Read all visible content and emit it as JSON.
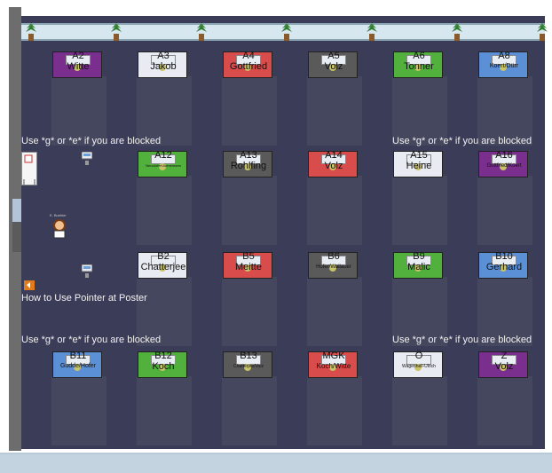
{
  "booths": [
    {
      "code": "A2",
      "name": "Witte",
      "color": "#7a2e8e",
      "name_size": 11
    },
    {
      "code": "A3",
      "name": "Jakob",
      "color": "#e8ebf2",
      "name_size": 11
    },
    {
      "code": "A4",
      "name": "Gottfried",
      "color": "#d94c4c",
      "name_size": 11
    },
    {
      "code": "A5",
      "name": "Volz",
      "color": "#5a5a5a",
      "name_size": 11
    },
    {
      "code": "A6",
      "name": "Tonner",
      "color": "#52b13c",
      "name_size": 11
    },
    {
      "code": "A8",
      "name": "Koert/Dürr",
      "color": "#5b8fd6",
      "name_size": 7
    },
    {
      "code": "A12",
      "name": "Neudörfer/Juenemann",
      "color": "#52b13c",
      "name_size": 4
    },
    {
      "code": "A13",
      "name": "Rohlfing",
      "color": "#5a5a5a",
      "name_size": 11
    },
    {
      "code": "A14",
      "name": "Volz",
      "color": "#d94c4c",
      "name_size": 11
    },
    {
      "code": "A15",
      "name": "Heine",
      "color": "#e8ebf2",
      "name_size": 11
    },
    {
      "code": "A16",
      "name": "Gottfried/Koert",
      "color": "#7a2e8e",
      "name_size": 6
    },
    {
      "code": "B2",
      "name": "Chatterjee",
      "color": "#e8ebf2",
      "name_size": 11
    },
    {
      "code": "B5",
      "name": "Meitte",
      "color": "#d94c4c",
      "name_size": 11
    },
    {
      "code": "B6",
      "name": "Hofer/Wallauer",
      "color": "#5a5a5a",
      "name_size": 6
    },
    {
      "code": "B9",
      "name": "Malic",
      "color": "#52b13c",
      "name_size": 11
    },
    {
      "code": "B10",
      "name": "Gerhard",
      "color": "#5b8fd6",
      "name_size": 11
    },
    {
      "code": "B11",
      "name": "Gudde/Hofer",
      "color": "#5b8fd6",
      "name_size": 7
    },
    {
      "code": "B12",
      "name": "Koch",
      "color": "#52b13c",
      "name_size": 11
    },
    {
      "code": "B13",
      "name": "Chatterjee/Volz",
      "color": "#5a5a5a",
      "name_size": 5
    },
    {
      "code": "MGK",
      "name": "Koch/Witte",
      "color": "#d94c4c",
      "name_size": 8
    },
    {
      "code": "Ö",
      "name": "Wagenheil-Ulrich",
      "color": "#e8ebf2",
      "name_size": 5
    },
    {
      "code": "Z",
      "name": "Volz",
      "color": "#7a2e8e",
      "name_size": 11
    }
  ],
  "messages": {
    "blocked": "Use *g* or *e* if you are blocked",
    "howto": "How to Use Pointer at Poster"
  },
  "avatar": {
    "name": "E. Buehler"
  },
  "colors": {
    "room": "#3b3c58",
    "desk": "#44475e",
    "wall": "#6d6d6d"
  }
}
